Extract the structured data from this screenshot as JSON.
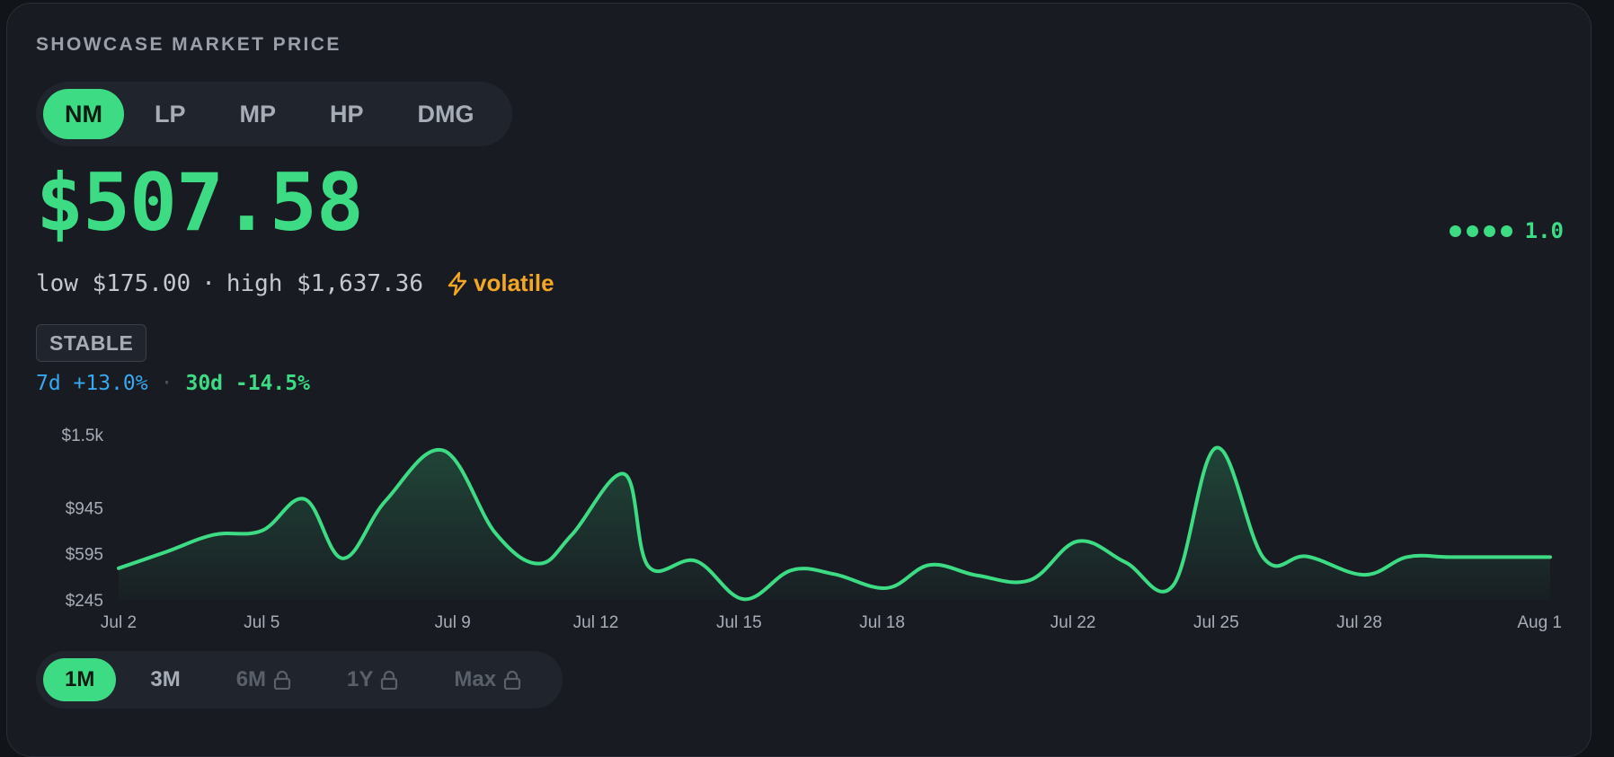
{
  "header": {
    "title": "SHOWCASE MARKET PRICE"
  },
  "conditions": [
    {
      "label": "NM",
      "active": true
    },
    {
      "label": "LP",
      "active": false
    },
    {
      "label": "MP",
      "active": false
    },
    {
      "label": "HP",
      "active": false
    },
    {
      "label": "DMG",
      "active": false
    }
  ],
  "price": {
    "value": "$507.58"
  },
  "rating": {
    "dots": 4,
    "value": "1.0"
  },
  "range": {
    "low": "low $175.00",
    "separator": "·",
    "high": "high $1,637.36",
    "volatility": "volatile"
  },
  "trend": {
    "label": "STABLE"
  },
  "changes": {
    "d7": "7d +13.0%",
    "separator": "·",
    "d30": "30d -14.5%"
  },
  "timeframes": [
    {
      "label": "1M",
      "active": true,
      "locked": false
    },
    {
      "label": "3M",
      "active": false,
      "locked": false
    },
    {
      "label": "6M",
      "active": false,
      "locked": true
    },
    {
      "label": "1Y",
      "active": false,
      "locked": true
    },
    {
      "label": "Max",
      "active": false,
      "locked": true
    }
  ],
  "colors": {
    "accent": "#3ddc84",
    "change_7d": "#38a9ee",
    "volatile": "#f5a623",
    "card": "#181b22"
  },
  "icons": {
    "volatile": "lightning-icon",
    "locked": "lock-icon"
  },
  "chart_data": {
    "type": "area",
    "title": "",
    "xlabel": "",
    "ylabel": "",
    "ylim": [
      245,
      1500
    ],
    "yticks": [
      {
        "value": 1500,
        "label": "$1.5k"
      },
      {
        "value": 945,
        "label": "$945"
      },
      {
        "value": 595,
        "label": "$595"
      },
      {
        "value": 245,
        "label": "$245"
      }
    ],
    "xticks": [
      {
        "day": 1,
        "label": "Jul 2"
      },
      {
        "day": 4,
        "label": "Jul 5"
      },
      {
        "day": 8,
        "label": "Jul 9"
      },
      {
        "day": 11,
        "label": "Jul 12"
      },
      {
        "day": 14,
        "label": "Jul 15"
      },
      {
        "day": 17,
        "label": "Jul 18"
      },
      {
        "day": 21,
        "label": "Jul 22"
      },
      {
        "day": 24,
        "label": "Jul 25"
      },
      {
        "day": 27,
        "label": "Jul 28"
      },
      {
        "day": 31,
        "label": "Aug 1"
      }
    ],
    "grid": false,
    "legend": "none",
    "series": [
      {
        "x": [
          1,
          2,
          3,
          4,
          4.9,
          5.7,
          6.6,
          7.8,
          8.9,
          9.8,
          10.5,
          11.6,
          12.1,
          13.1,
          14.1,
          15.1,
          16.0,
          17.1,
          18.0,
          19.0,
          20.1,
          21.1,
          22.1,
          23.1,
          24.0,
          25.0,
          25.9,
          27.1,
          28.0,
          28.9,
          30.0,
          31.0
        ],
        "y": [
          485,
          610,
          740,
          770,
          1010,
          560,
          1000,
          1380,
          750,
          520,
          740,
          1200,
          500,
          540,
          250,
          470,
          440,
          335,
          510,
          430,
          395,
          690,
          530,
          355,
          1400,
          560,
          575,
          435,
          570,
          570,
          570,
          570
        ]
      }
    ]
  }
}
